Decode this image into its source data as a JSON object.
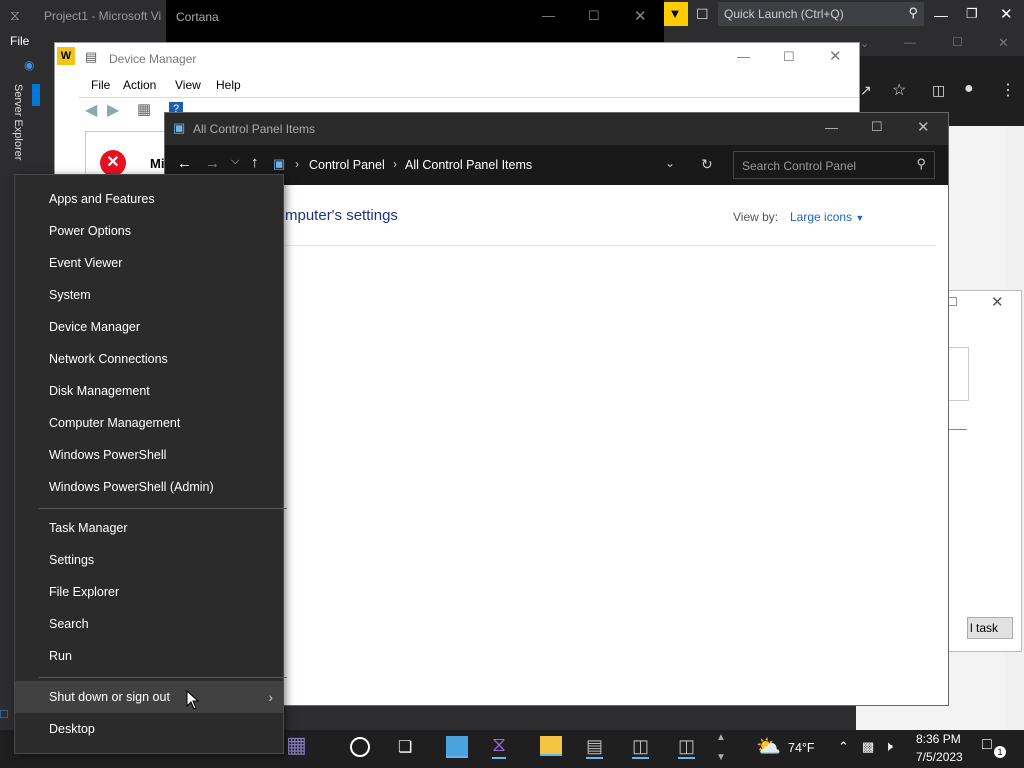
{
  "vs": {
    "title": "Project1 - Microsoft Vi",
    "file_menu": "File",
    "quick_launch_placeholder": "Quick Launch (Ctrl+Q)",
    "server_explorer": "Server Explorer"
  },
  "cortana": {
    "title": "Cortana"
  },
  "device_manager": {
    "title": "Device Manager",
    "menu": [
      "File",
      "Action",
      "View",
      "Help"
    ],
    "partial_label": "Mi"
  },
  "control_panel": {
    "title": "All Control Panel Items",
    "breadcrumb": [
      "Control Panel",
      "All Control Panel Items"
    ],
    "search_placeholder": "Search Control Panel",
    "heading_partial": "mputer's settings",
    "view_by_label": "View by:",
    "view_by_value": "Large icons"
  },
  "task_dialog": {
    "button_partial": "l task"
  },
  "winx_menu": {
    "group1": [
      "Apps and Features",
      "Power Options",
      "Event Viewer",
      "System",
      "Device Manager",
      "Network Connections",
      "Disk Management",
      "Computer Management",
      "Windows PowerShell",
      "Windows PowerShell (Admin)"
    ],
    "group2": [
      "Task Manager",
      "Settings",
      "File Explorer",
      "Search",
      "Run"
    ],
    "shutdown": "Shut down or sign out",
    "desktop": "Desktop"
  },
  "taskbar": {
    "weather": "74°F",
    "time": "8:36 PM",
    "date": "7/5/2023",
    "notification_count": "1"
  },
  "colors": {
    "accent_blue": "#0078d7",
    "menu_bg": "#2b2b2b",
    "vs_yellow": "#ffcc00",
    "error_red": "#e81123"
  }
}
